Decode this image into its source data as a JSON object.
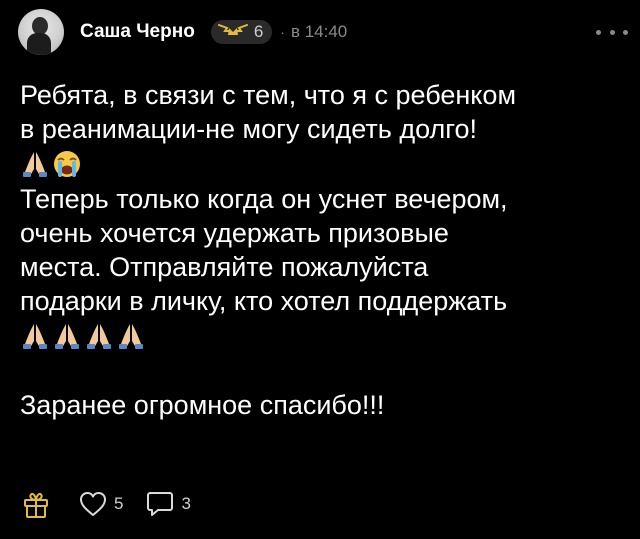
{
  "post": {
    "author": "Саша Черно",
    "badge_level": "6",
    "time": "в 14:40",
    "body": {
      "line1": "Ребята, в связи с тем, что я с ребенком",
      "line2": "в реанимации-не могу сидеть долго!",
      "line3": "Теперь только когда он уснет вечером,",
      "line4": "очень хочется удержать призовые",
      "line5": "места. Отправляйте пожалуйста",
      "line6": "подарки в личку, кто хотел поддержать",
      "line7": "Заранее огромное спасибо!!!"
    },
    "emoji_row1": [
      "folded-hands",
      "loudly-crying-face"
    ],
    "emoji_row2": [
      "folded-hands",
      "folded-hands",
      "folded-hands",
      "folded-hands"
    ]
  },
  "actions": {
    "likes": "5",
    "comments": "3"
  },
  "colors": {
    "background": "#000000",
    "text": "#ffffff",
    "muted": "#8a8a8a",
    "accent": "#e2bd35",
    "badge_bg": "#2a2a2a"
  },
  "icons": [
    "avatar",
    "crown-wings-icon",
    "more-icon",
    "gift-icon",
    "heart-icon",
    "comment-icon"
  ]
}
